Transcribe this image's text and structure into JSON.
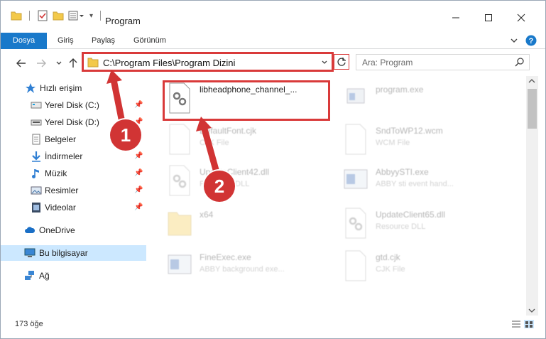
{
  "window": {
    "title": "Program"
  },
  "ribbon": {
    "tabs": [
      "Dosya",
      "Giriş",
      "Paylaş",
      "Görünüm"
    ]
  },
  "nav": {
    "address": "C:\\Program Files\\Program Dizini",
    "search_placeholder": "Ara: Program"
  },
  "sidebar": {
    "items": [
      {
        "label": "Hızlı erişim",
        "icon": "star-icon"
      },
      {
        "label": "Yerel Disk (C:)",
        "icon": "drive-icon",
        "pinned": true
      },
      {
        "label": "Yerel Disk (D:)",
        "icon": "drive-icon",
        "pinned": true
      },
      {
        "label": "Belgeler",
        "icon": "documents-icon",
        "pinned": true
      },
      {
        "label": "İndirmeler",
        "icon": "download-icon",
        "pinned": true
      },
      {
        "label": "Müzik",
        "icon": "music-icon",
        "pinned": true
      },
      {
        "label": "Resimler",
        "icon": "pictures-icon",
        "pinned": true
      },
      {
        "label": "Videolar",
        "icon": "videos-icon",
        "pinned": true
      },
      {
        "label": "OneDrive",
        "icon": "cloud-icon"
      },
      {
        "label": "Bu bilgisayar",
        "icon": "computer-icon",
        "selected": true
      },
      {
        "label": "Ağ",
        "icon": "network-icon"
      }
    ]
  },
  "files": [
    {
      "name": "libheadphone_channel_...",
      "desc": "",
      "icon": "settings-file-icon",
      "highlighted": true
    },
    {
      "name": "program.exe",
      "desc": "",
      "icon": "exe-icon"
    },
    {
      "name": "DefaultFont.cjk",
      "desc": "CJK File",
      "icon": "blank-file-icon"
    },
    {
      "name": "SndToWP12.wcm",
      "desc": "WCM File",
      "icon": "blank-file-icon"
    },
    {
      "name": "UpdateClient42.dll",
      "desc": "Resource DLL",
      "icon": "settings-file-icon"
    },
    {
      "name": "AbbyySTI.exe",
      "desc": "ABBY sti event hand...",
      "icon": "exe-icon"
    },
    {
      "name": "x64",
      "desc": "",
      "icon": "folder-icon"
    },
    {
      "name": "UpdateClient65.dll",
      "desc": "Resource DLL",
      "icon": "settings-file-icon"
    },
    {
      "name": "FineExec.exe",
      "desc": "ABBY background exe...",
      "icon": "exe-icon"
    },
    {
      "name": "gtd.cjk",
      "desc": "CJK File",
      "icon": "blank-file-icon"
    }
  ],
  "status": {
    "count": "173 öğe"
  },
  "callouts": [
    "1",
    "2"
  ],
  "colors": {
    "accent": "#1979ca",
    "highlight": "#d93a3a",
    "selected": "#cce8ff"
  }
}
